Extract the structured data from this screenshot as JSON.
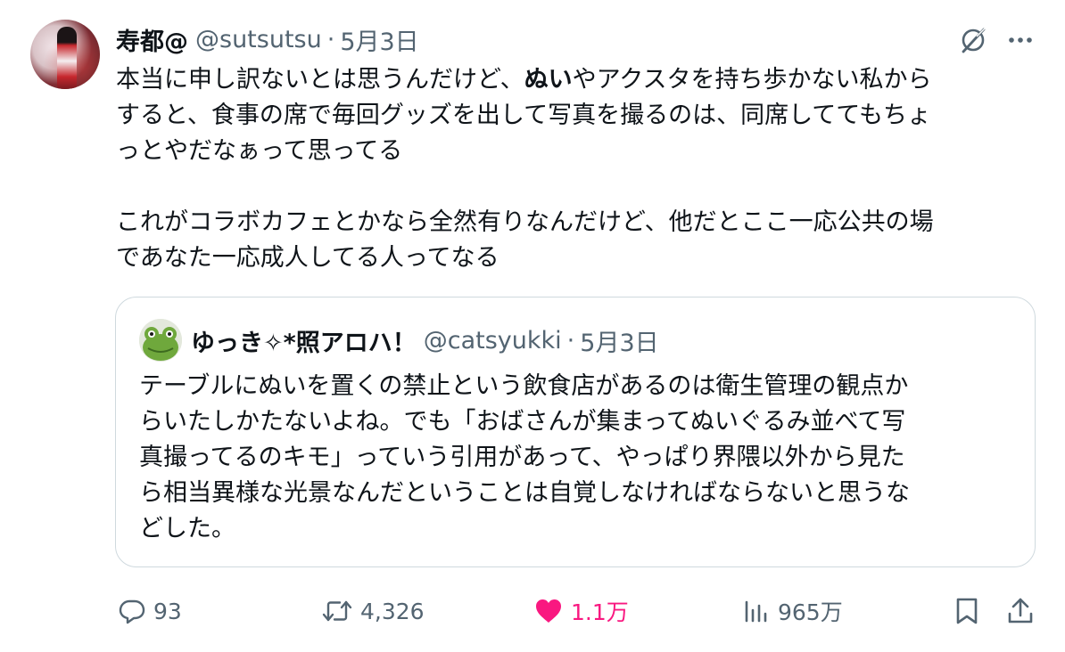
{
  "tweet": {
    "author": {
      "display_name": "寿都@",
      "handle": "@sutsutsu",
      "separator": "·",
      "date": "5月3日"
    },
    "text": {
      "line1_a": "本当に申し訳ないとは思うんだけど、",
      "line1_bold": "ぬい",
      "line1_b": "やアクスタを持ち歩かない私から",
      "line2": "すると、食事の席で毎回グッズを出して写真を撮るのは、同席しててもちょ",
      "line3": "っとやだなぁって思ってる",
      "line4": "これがコラボカフェとかなら全然有りなんだけど、他だとここ一応公共の場",
      "line5": "であなた一応成人してる人ってなる"
    },
    "icons": {
      "grok": "grok-icon",
      "more": "more-icon"
    }
  },
  "quote": {
    "author": {
      "display_name": "ゆっき✧*照アロハ！",
      "handle": "@catsyukki",
      "separator": "·",
      "date": "5月3日"
    },
    "text": {
      "line1": "テーブルにぬいを置くの禁止という飲食店があるのは衛生管理の観点か",
      "line2": "らいたしかたないよね。でも「おばさんが集まってぬいぐるみ並べて写",
      "line3": "真撮ってるのキモ」っていう引用があって、やっぱり界隈以外から見た",
      "line4": "ら相当異様な光景なんだということは自覚しなければならないと思うな",
      "line5": "どした。"
    }
  },
  "actions": {
    "reply": {
      "icon": "reply-icon",
      "count": "93"
    },
    "retweet": {
      "icon": "retweet-icon",
      "count": "4,326"
    },
    "like": {
      "icon": "heart-icon",
      "count": "1.1万",
      "color": "#f91880"
    },
    "views": {
      "icon": "views-icon",
      "count": "965万"
    },
    "bookmark": {
      "icon": "bookmark-icon"
    },
    "share": {
      "icon": "share-icon"
    }
  },
  "colors": {
    "text_primary": "#0f1419",
    "text_secondary": "#536471",
    "border": "#cfd9de",
    "like_active": "#f91880"
  }
}
